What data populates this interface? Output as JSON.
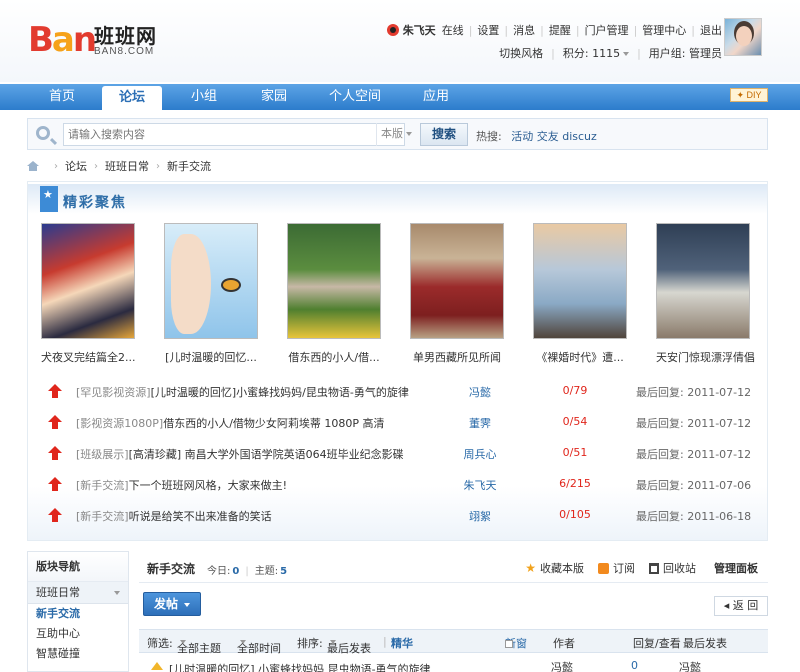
{
  "brand": {
    "logo_ban": [
      "B",
      "a",
      "n"
    ],
    "logo_cn": "班班网",
    "logo_en": "BAN8.COM"
  },
  "user": {
    "name": "朱飞天",
    "status": "在线",
    "links": [
      "设置",
      "消息",
      "提醒",
      "门户管理",
      "管理中心",
      "退出"
    ],
    "style_switch": "切换风格",
    "points_label": "积分: 1115",
    "group_label": "用户组: 管理员"
  },
  "nav": {
    "tabs": [
      "首页",
      "论坛",
      "小组",
      "家园",
      "个人空间",
      "应用"
    ],
    "active": "论坛",
    "diy": "DIY"
  },
  "search": {
    "placeholder": "请输入搜索内容",
    "scope": "本版",
    "button": "搜索",
    "hot_label": "热搜:",
    "hot_words": [
      "活动",
      "交友",
      "discuz"
    ]
  },
  "breadcrumb": [
    "论坛",
    "班班日常",
    "新手交流"
  ],
  "focus": {
    "title": "精彩聚焦",
    "pics": [
      {
        "caption": "犬夜叉完结篇全2..."
      },
      {
        "caption": "[儿时温暖的回忆..."
      },
      {
        "caption": "借东西的小人/借..."
      },
      {
        "caption": "单男西藏所见所闻"
      },
      {
        "caption": "《裸婚时代》遭..."
      },
      {
        "caption": "天安门惊现漂浮倩倡"
      }
    ],
    "threads": [
      {
        "cat": "[罕见影视资源]",
        "title": "[儿时温暖的回忆]小蜜蜂找妈妈/昆虫物语-勇气的旋律",
        "author": "冯懿",
        "count": "0/79",
        "last": "最后回复: 2011-07-12"
      },
      {
        "cat": "[影视资源1080P]",
        "title": "借东西的小人/借物少女阿莉埃蒂 1080P 高清",
        "author": "董霁",
        "count": "0/54",
        "last": "最后回复: 2011-07-12"
      },
      {
        "cat": "[班级展示]",
        "title": "[高清珍藏] 南昌大学外国语学院英语064班毕业纪念影碟",
        "author": "周兵心",
        "count": "0/51",
        "last": "最后回复: 2011-07-12"
      },
      {
        "cat": "[新手交流]",
        "title": "下一个班班网风格，大家来做主!",
        "author": "朱飞天",
        "count": "6/215",
        "last": "最后回复: 2011-07-06"
      },
      {
        "cat": "[新手交流]",
        "title": "听说是给笑不出来准备的笑话",
        "author": "翊絮",
        "count": "0/105",
        "last": "最后回复: 2011-06-18"
      }
    ]
  },
  "sidebar": {
    "title": "版块导航",
    "group": "班班日常",
    "items": [
      "新手交流",
      "互助中心",
      "智慧碰撞"
    ]
  },
  "forum": {
    "name": "新手交流",
    "today_label": "今日:",
    "today": "0",
    "topics_label": "主题:",
    "topics": "5",
    "tools": {
      "favorite": "收藏本版",
      "subscribe": "订阅",
      "recycle": "回收站",
      "manage": "管理面板"
    },
    "post_button": "发帖",
    "back_button": "返 回",
    "filter": {
      "label": "筛选:",
      "all_topics": "全部主题",
      "all_time": "全部时间",
      "sort": "排序:",
      "sort_value": "最后发表",
      "digest": "精华",
      "new_window": "新窗",
      "author_col": "作者",
      "reply_col": "回复/查看",
      "last_col": "最后发表"
    },
    "row": {
      "title": "[儿时温暖的回忆] 小蜜蜂找妈妈 昆虫物语-勇气的旋律",
      "author": "冯懿",
      "replies": "0",
      "last": "冯懿"
    }
  }
}
